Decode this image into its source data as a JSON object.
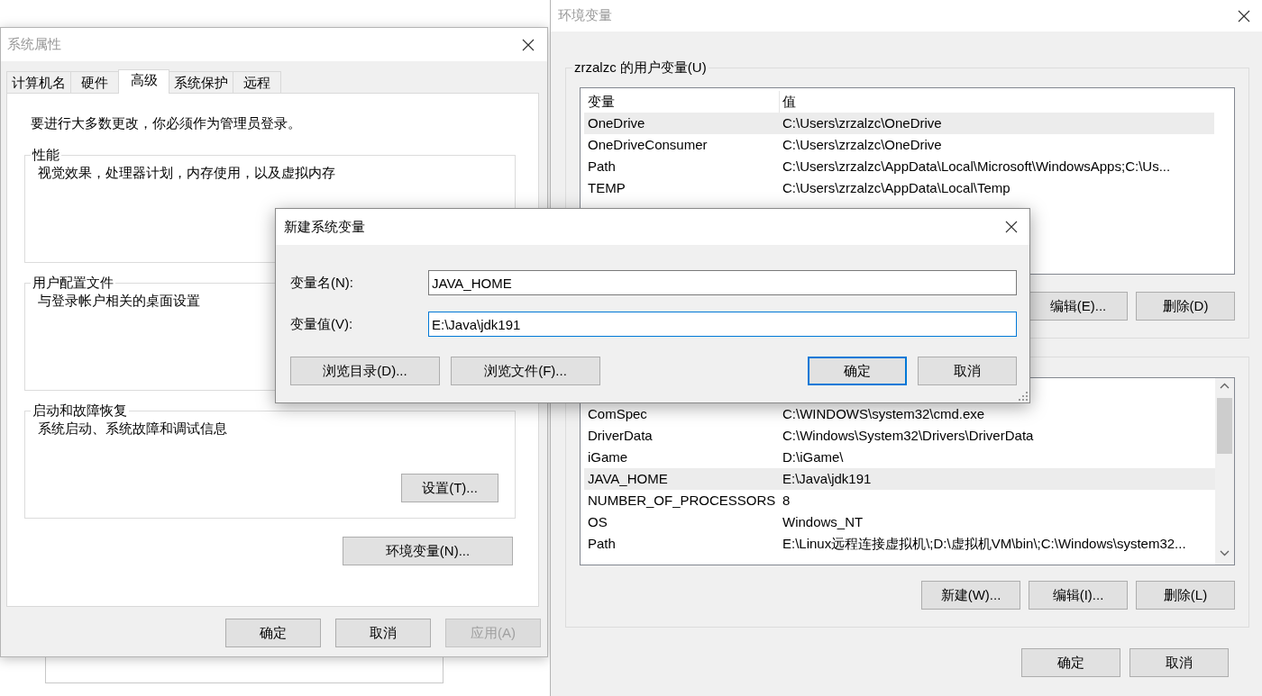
{
  "system_properties": {
    "title": "系统属性",
    "active": false,
    "tabs": [
      {
        "label": "计算机名",
        "selected": false
      },
      {
        "label": "硬件",
        "selected": false
      },
      {
        "label": "高级",
        "selected": true
      },
      {
        "label": "系统保护",
        "selected": false
      },
      {
        "label": "远程",
        "selected": false
      }
    ],
    "notice": "要进行大多数更改，你必须作为管理员登录。",
    "groups": [
      {
        "label": "性能",
        "description": "视觉效果，处理器计划，内存使用，以及虚拟内存"
      },
      {
        "label": "用户配置文件",
        "description": "与登录帐户相关的桌面设置"
      },
      {
        "label": "启动和故障恢复",
        "description": "系统启动、系统故障和调试信息",
        "button": "设置(T)..."
      }
    ],
    "env_button": "环境变量(N)...",
    "buttons": [
      {
        "label": "确定",
        "disabled": false
      },
      {
        "label": "取消",
        "disabled": false
      },
      {
        "label": "应用(A)",
        "disabled": true
      }
    ]
  },
  "environment_variables": {
    "title": "环境变量",
    "active": false,
    "user_variables": {
      "label": "zrzalzc 的用户变量(U)",
      "columns": [
        "变量",
        "值"
      ],
      "rows": [
        {
          "name": "OneDrive",
          "value": "C:\\Users\\zrzalzc\\OneDrive",
          "selected": true
        },
        {
          "name": "OneDriveConsumer",
          "value": "C:\\Users\\zrzalzc\\OneDrive",
          "selected": false
        },
        {
          "name": "Path",
          "value": "C:\\Users\\zrzalzc\\AppData\\Local\\Microsoft\\WindowsApps;C:\\Us...",
          "selected": false
        },
        {
          "name": "TEMP",
          "value": "C:\\Users\\zrzalzc\\AppData\\Local\\Temp",
          "selected": false
        }
      ],
      "buttons": [
        "编辑(E)...",
        "删除(D)"
      ]
    },
    "system_variables": {
      "rows": [
        {
          "name": "ComSpec",
          "value": "C:\\WINDOWS\\system32\\cmd.exe",
          "selected": false
        },
        {
          "name": "DriverData",
          "value": "C:\\Windows\\System32\\Drivers\\DriverData",
          "selected": false
        },
        {
          "name": "iGame",
          "value": "D:\\iGame\\",
          "selected": false
        },
        {
          "name": "JAVA_HOME",
          "value": "E:\\Java\\jdk191",
          "selected": true
        },
        {
          "name": "NUMBER_OF_PROCESSORS",
          "value": "8",
          "selected": false
        },
        {
          "name": "OS",
          "value": "Windows_NT",
          "selected": false
        },
        {
          "name": "Path",
          "value": "E:\\Linux远程连接虚拟机\\;D:\\虚拟机VM\\bin\\;C:\\Windows\\system32...",
          "selected": false
        }
      ],
      "buttons": [
        "新建(W)...",
        "编辑(I)...",
        "删除(L)"
      ]
    },
    "buttons": [
      "确定",
      "取消"
    ]
  },
  "new_variable_dialog": {
    "title": "新建系统变量",
    "active": true,
    "fields": [
      {
        "label": "变量名(N):",
        "value": "JAVA_HOME",
        "focused": false
      },
      {
        "label": "变量值(V):",
        "value": "E:\\Java\\jdk191",
        "focused": true
      }
    ],
    "browse_buttons": [
      {
        "label": "浏览目录(D)...",
        "default": false
      },
      {
        "label": "浏览文件(F)...",
        "default": false
      }
    ],
    "buttons": [
      {
        "label": "确定",
        "default": true
      },
      {
        "label": "取消",
        "default": false
      }
    ]
  }
}
